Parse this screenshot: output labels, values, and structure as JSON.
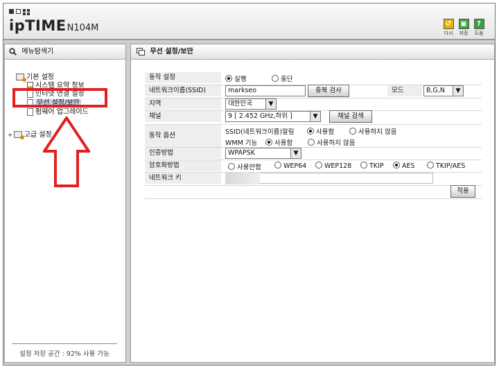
{
  "header": {
    "brand": "ipTIME",
    "model": "N104M",
    "toolbar": [
      {
        "label": "다시",
        "icon": "refresh-icon",
        "color": "#e8b000",
        "glyph": "↺"
      },
      {
        "label": "저장",
        "icon": "save-icon",
        "color": "#3aa23a",
        "glyph": "▣"
      },
      {
        "label": "도움",
        "icon": "help-icon",
        "color": "#3aa23a",
        "glyph": "?"
      }
    ]
  },
  "sidebar": {
    "title": "메뉴탐색기",
    "groups": [
      {
        "label": "기본 설정",
        "items": [
          {
            "label": "시스템 요약 정보"
          },
          {
            "label": "인터넷 연결 설정"
          },
          {
            "label": "무선 설정/보안"
          },
          {
            "label": "펌웨어 업그레이드"
          }
        ]
      },
      {
        "label": "고급 설정"
      }
    ],
    "storage": "설정 저장 공간 : 92% 사용 가능"
  },
  "main": {
    "title": "무선 설정/보안",
    "operation": {
      "label": "동작 설정",
      "options": [
        "실행",
        "중단"
      ],
      "selected": "실행"
    },
    "ssid": {
      "label": "네트워크이름(SSID)",
      "value": "markseo",
      "dup_check": "중복 검사"
    },
    "mode": {
      "label": "모드",
      "value": "B,G,N"
    },
    "region": {
      "label": "지역",
      "value": "대한민국"
    },
    "channel": {
      "label": "채널",
      "value": "9 [ 2.452 GHz,하위 ]",
      "search": "채널 검색"
    },
    "options": {
      "label": "동작 옵션",
      "ssid_broadcast": {
        "label": "SSID(네트워크이름)알림",
        "options": [
          "사용함",
          "사용하지 않음"
        ],
        "selected": "사용함"
      },
      "wmm": {
        "label": "WMM 기능",
        "options": [
          "사용함",
          "사용하지 않음"
        ],
        "selected": "사용함"
      }
    },
    "auth": {
      "label": "인증방법",
      "value": "WPAPSK"
    },
    "encryption": {
      "label": "암호화방법",
      "options": [
        "사용안함",
        "WEP64",
        "WEP128",
        "TKIP",
        "AES",
        "TKIP/AES"
      ],
      "selected": "AES"
    },
    "network_key": {
      "label": "네트워크 키",
      "value": ""
    },
    "apply": "적용"
  },
  "colors": {
    "highlight": "#e02020",
    "selected_item": "#c8d0e8"
  }
}
